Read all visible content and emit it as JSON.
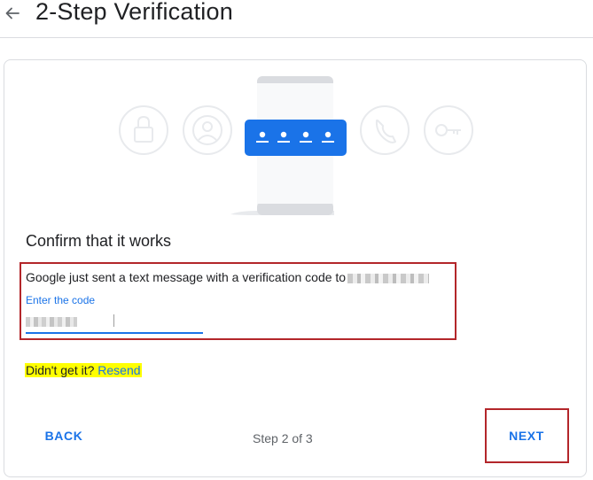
{
  "header": {
    "title": "2-Step Verification",
    "back_icon": "arrow-left-icon"
  },
  "illustration": {
    "icons": [
      "lock-icon",
      "user-circle-icon",
      "phone-icon",
      "key-icon"
    ],
    "accent_color": "#1a73e8"
  },
  "confirm": {
    "title": "Confirm that it works",
    "description": "Google just sent a text message with a verification code to",
    "code_label": "Enter the code",
    "code_placeholder": ""
  },
  "resend": {
    "question": "Didn't get it?",
    "link_label": "Resend"
  },
  "footer": {
    "back_label": "BACK",
    "step_text": "Step 2 of 3",
    "next_label": "NEXT"
  },
  "colors": {
    "accent": "#1a73e8",
    "annotation_red": "#b3262a",
    "highlight_yellow": "#ffff00"
  }
}
